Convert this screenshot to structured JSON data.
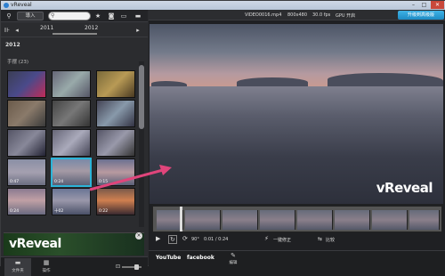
{
  "window": {
    "title": "vReveal",
    "minimize": "–",
    "maximize": "□",
    "close": "✕"
  },
  "toolbar": {
    "import_label": "導入",
    "search_placeholder": ""
  },
  "timeline": {
    "year_left": "2011",
    "year_right": "2012"
  },
  "library": {
    "year_heading": "2012",
    "group_label": "手摆 (23)",
    "thumbnails": [
      {
        "time": ""
      },
      {
        "time": ""
      },
      {
        "time": ""
      },
      {
        "time": ""
      },
      {
        "time": ""
      },
      {
        "time": ""
      },
      {
        "time": ""
      },
      {
        "time": ""
      },
      {
        "time": ""
      },
      {
        "time": "0:47"
      },
      {
        "time": "0:24"
      },
      {
        "time": "0:15"
      },
      {
        "time": "0:24"
      },
      {
        "time": "十02"
      },
      {
        "time": "0:22"
      }
    ]
  },
  "promo": {
    "brand": "vReveal",
    "close": "×"
  },
  "bottom_tabs": [
    {
      "icon": "folder-icon",
      "label": "文件夹"
    },
    {
      "icon": "grid-icon",
      "label": "操作"
    }
  ],
  "video_info": {
    "filename": "VIDEO0016.mp4",
    "resolution": "800x480",
    "fps": "30.0 fps",
    "gpu": "GPU 开启",
    "upgrade_label": "升级到高级版"
  },
  "video": {
    "watermark": "vReveal"
  },
  "playback": {
    "rotation": "90°",
    "time": "0:01 / 0:24",
    "fix_label": "一键修正",
    "compare_label": "比较"
  },
  "share": {
    "youtube": "YouTube",
    "facebook": "facebook",
    "edit_label": "编辑"
  },
  "colors": {
    "accent": "#2bb4d8",
    "upgrade": "#1d8bc4",
    "arrow": "#e0457b"
  }
}
